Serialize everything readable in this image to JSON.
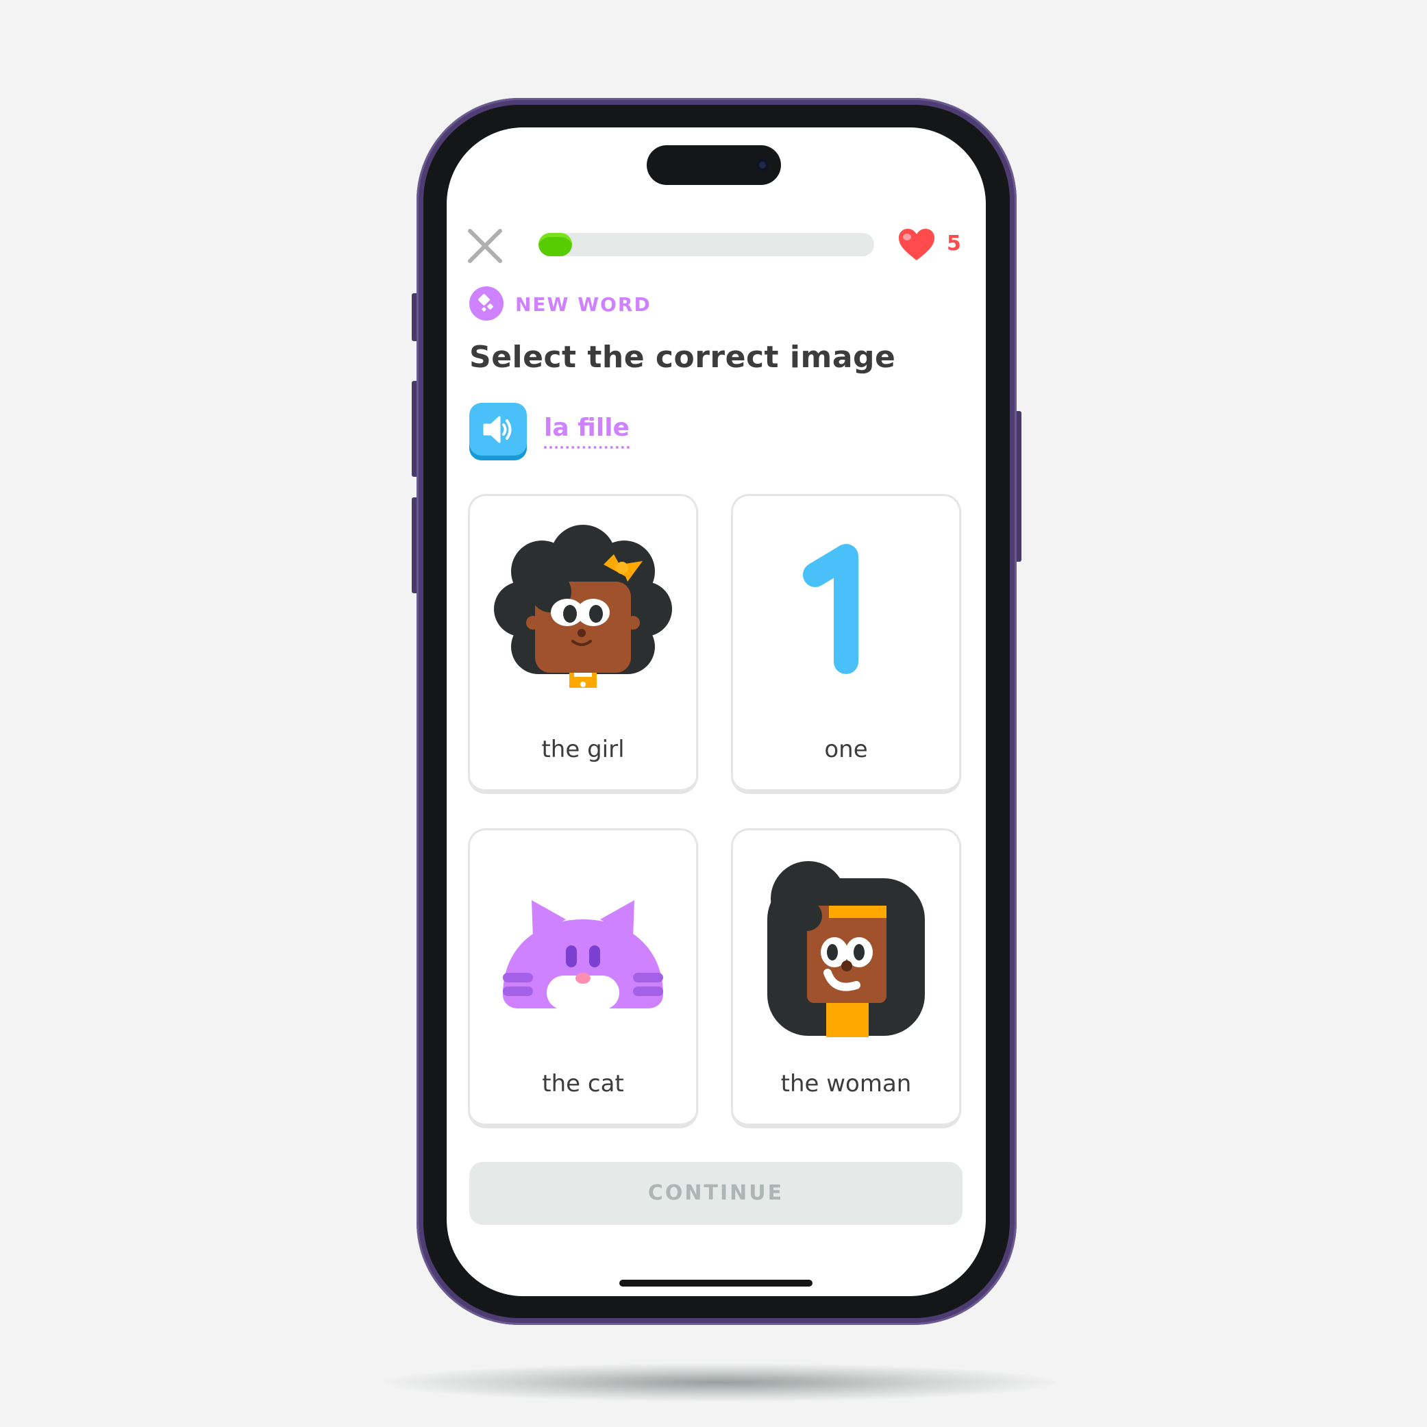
{
  "progress": {
    "fraction": 0.1,
    "fill_color": "#58cc02"
  },
  "hearts": {
    "count": "5",
    "icon": "heart-icon",
    "color": "#ff4b4b"
  },
  "badge": {
    "label": "NEW WORD",
    "icon": "new-word-icon",
    "color": "#ce82ff"
  },
  "prompt": {
    "title": "Select the correct image",
    "word": "la fille",
    "speaker_icon": "speaker-icon"
  },
  "options": [
    {
      "label": "the girl",
      "art": "girl-illustration"
    },
    {
      "label": "one",
      "art": "number-one-illustration"
    },
    {
      "label": "the cat",
      "art": "cat-illustration"
    },
    {
      "label": "the woman",
      "art": "woman-illustration"
    }
  ],
  "footer": {
    "continue_label": "CONTINUE"
  },
  "colors": {
    "accent_purple": "#ce82ff",
    "accent_blue": "#49c0f8",
    "text_dark": "#3c3c3c",
    "disabled_gray": "#e5e9e8",
    "phone_frame": "#4e3d72"
  }
}
